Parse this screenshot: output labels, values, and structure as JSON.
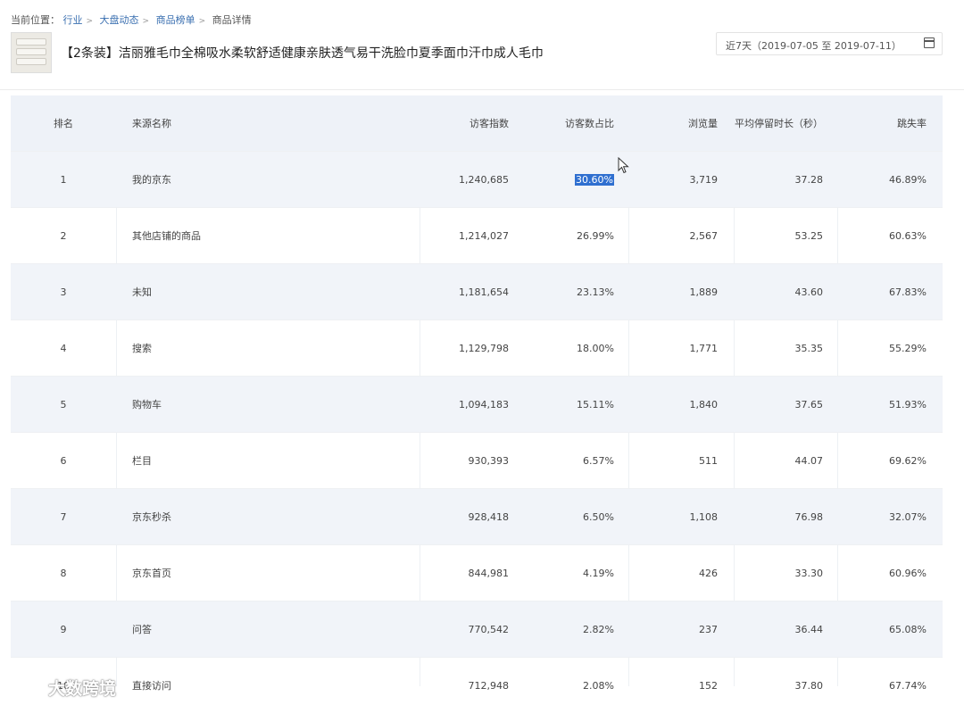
{
  "breadcrumb": {
    "label": "当前位置：",
    "items": [
      "行业",
      "大盘动态",
      "商品榜单",
      "商品详情"
    ]
  },
  "product": {
    "title": "【2条装】洁丽雅毛巾全棉吸水柔软舒适健康亲肤透气易干洗脸巾夏季面巾汗巾成人毛巾"
  },
  "date_range": "近7天（2019-07-05 至 2019-07-11）",
  "table": {
    "headers": {
      "rank": "排名",
      "source": "来源名称",
      "visitors": "访客指数",
      "share": "访客数占比",
      "views": "浏览量",
      "stay": "平均停留时长（秒）",
      "bounce": "跳失率"
    },
    "rows": [
      {
        "rank": "1",
        "source": "我的京东",
        "visitors": "1,240,685",
        "share": "30.60%",
        "views": "3,719",
        "stay": "37.28",
        "bounce": "46.89%"
      },
      {
        "rank": "2",
        "source": "其他店铺的商品",
        "visitors": "1,214,027",
        "share": "26.99%",
        "views": "2,567",
        "stay": "53.25",
        "bounce": "60.63%"
      },
      {
        "rank": "3",
        "source": "未知",
        "visitors": "1,181,654",
        "share": "23.13%",
        "views": "1,889",
        "stay": "43.60",
        "bounce": "67.83%"
      },
      {
        "rank": "4",
        "source": "搜索",
        "visitors": "1,129,798",
        "share": "18.00%",
        "views": "1,771",
        "stay": "35.35",
        "bounce": "55.29%"
      },
      {
        "rank": "5",
        "source": "购物车",
        "visitors": "1,094,183",
        "share": "15.11%",
        "views": "1,840",
        "stay": "37.65",
        "bounce": "51.93%"
      },
      {
        "rank": "6",
        "source": "栏目",
        "visitors": "930,393",
        "share": "6.57%",
        "views": "511",
        "stay": "44.07",
        "bounce": "69.62%"
      },
      {
        "rank": "7",
        "source": "京东秒杀",
        "visitors": "928,418",
        "share": "6.50%",
        "views": "1,108",
        "stay": "76.98",
        "bounce": "32.07%"
      },
      {
        "rank": "8",
        "source": "京东首页",
        "visitors": "844,981",
        "share": "4.19%",
        "views": "426",
        "stay": "33.30",
        "bounce": "60.96%"
      },
      {
        "rank": "9",
        "source": "问答",
        "visitors": "770,542",
        "share": "2.82%",
        "views": "237",
        "stay": "36.44",
        "bounce": "65.08%"
      },
      {
        "rank": "10",
        "source": "直接访问",
        "visitors": "712,948",
        "share": "2.08%",
        "views": "152",
        "stay": "37.80",
        "bounce": "67.74%"
      }
    ]
  },
  "watermark": "大数跨境",
  "colors": {
    "link": "#3a6fb0",
    "selection": "#2f6fd0",
    "header_bg": "#eef2f8",
    "alt_row_bg": "#f1f4f9"
  }
}
